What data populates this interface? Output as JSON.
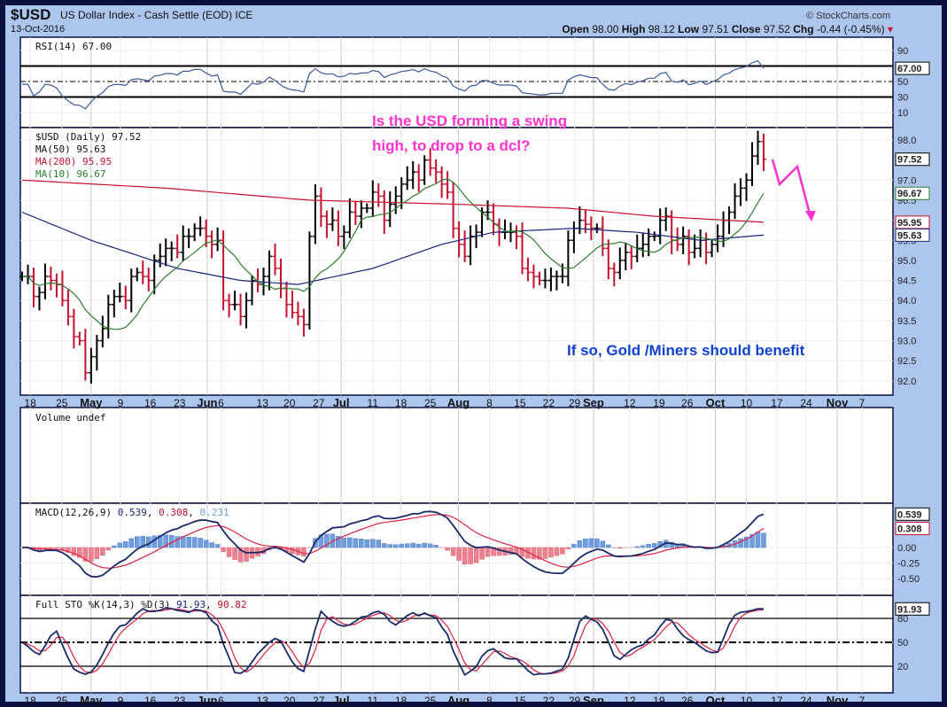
{
  "header": {
    "symbol": "$USD",
    "name": "US Dollar Index - Cash Settle (EOD) ICE",
    "date": "13-Oct-2016",
    "brand": "© StockCharts.com",
    "open_label": "Open",
    "open": "98.00",
    "high_label": "High",
    "high": "98.12",
    "low_label": "Low",
    "low": "97.51",
    "close_label": "Close",
    "close": "97.52",
    "chg_label": "Chg",
    "chg": "-0.44 (-0.45%)"
  },
  "annotations": {
    "question_line1": "Is the USD forming a swing",
    "question_line2": "high, to drop to a dcl?",
    "note": "If so, Gold /Miners should benefit"
  },
  "colors": {
    "up": "#000000",
    "down": "#c8102e",
    "ma50": "#1a237e",
    "ma200": "#c8102e",
    "ma10": "#2e7d32",
    "annot_pink": "#ff33cc",
    "annot_blue": "#1040d0",
    "rsi": "#3a5a9a",
    "hist_pos": "#6f9ee0",
    "hist_neg": "#f08090"
  },
  "chart_data": [
    {
      "type": "line",
      "title": "RSI(14) 67.00",
      "legend": "RSI(14) 67.00",
      "last_label": "67.00",
      "ylim": [
        0,
        100
      ],
      "yticks": [
        "90",
        "70",
        "50",
        "30",
        "10"
      ],
      "ytick_values": [
        90,
        70,
        50,
        30,
        10
      ],
      "levels": [
        70,
        50,
        30
      ]
    },
    {
      "type": "ohlc",
      "title": "$USD (Daily) 97.52",
      "last_label": "97.52",
      "ylim": [
        91.7,
        98.3
      ],
      "legend": [
        {
          "name": "MA(50) 95.63",
          "label": "95.63"
        },
        {
          "name": "MA(200) 95.95",
          "label": "95.95"
        },
        {
          "name": "MA(10) 96.67",
          "label": "96.67"
        }
      ],
      "yticks": [
        "98.0",
        "97.0",
        "96.5",
        "96.0",
        "95.5",
        "95.0",
        "94.5",
        "94.0",
        "93.5",
        "93.0",
        "92.5",
        "92.0"
      ],
      "ytick_values": [
        98,
        97,
        96.5,
        96,
        95.5,
        95,
        94.5,
        94,
        93.5,
        93,
        92.5,
        92
      ],
      "close": [
        94.6,
        94.6,
        94.1,
        94.2,
        94.6,
        94.5,
        94.4,
        94.0,
        93.6,
        93.1,
        93.0,
        92.2,
        92.6,
        93.0,
        93.3,
        93.9,
        94.1,
        94.1,
        94.0,
        94.6,
        94.7,
        94.6,
        94.5,
        95.0,
        95.1,
        95.3,
        95.3,
        95.2,
        95.6,
        95.6,
        95.8,
        95.8,
        95.6,
        95.4,
        95.5,
        94.0,
        93.9,
        93.9,
        93.6,
        94.0,
        94.5,
        94.4,
        94.6,
        95.1,
        94.8,
        94.3,
        93.9,
        93.7,
        93.6,
        93.4,
        95.6,
        96.6,
        96.1,
        95.9,
        96.0,
        95.6,
        95.7,
        96.2,
        96.1,
        96.3,
        96.3,
        96.7,
        96.6,
        96.0,
        96.4,
        96.6,
        96.9,
        97.0,
        97.2,
        97.0,
        97.5,
        97.3,
        97.2,
        96.9,
        96.7,
        95.8,
        95.4,
        95.1,
        95.6,
        95.7,
        96.2,
        96.2,
        95.9,
        95.7,
        95.7,
        95.7,
        95.6,
        94.8,
        94.7,
        94.6,
        94.5,
        94.5,
        94.6,
        94.6,
        94.6,
        95.5,
        95.8,
        96.0,
        95.9,
        95.8,
        95.8,
        95.3,
        94.8,
        94.7,
        95.0,
        95.2,
        95.1,
        95.3,
        95.4,
        95.6,
        95.6,
        96.0,
        96.1,
        95.5,
        95.4,
        95.6,
        95.2,
        95.3,
        95.5,
        95.2,
        95.4,
        95.6,
        96.0,
        96.2,
        96.6,
        96.8,
        97.0,
        97.6,
        97.96,
        97.52
      ],
      "ma50": [
        [
          0,
          96.2
        ],
        [
          12,
          95.5
        ],
        [
          27,
          94.8
        ],
        [
          38,
          94.5
        ],
        [
          48,
          94.4
        ],
        [
          61,
          94.8
        ],
        [
          73,
          95.4
        ],
        [
          82,
          95.7
        ],
        [
          96,
          95.8
        ],
        [
          107,
          95.7
        ],
        [
          118,
          95.5
        ],
        [
          129,
          95.63
        ]
      ],
      "ma200": [
        [
          0,
          97.0
        ],
        [
          25,
          96.8
        ],
        [
          50,
          96.5
        ],
        [
          75,
          96.4
        ],
        [
          95,
          96.3
        ],
        [
          110,
          96.1
        ],
        [
          129,
          95.95
        ]
      ]
    },
    {
      "type": "bar",
      "title": "Volume undef"
    },
    {
      "type": "line+bar",
      "title": "MACD(12,26,9)",
      "legend_values": [
        "0.539",
        "0.308",
        "0.231"
      ],
      "last_labels": [
        "0.539",
        "0.308"
      ],
      "yticks": [
        "0.00",
        "-0.25",
        "-0.50"
      ],
      "ytick_values": [
        0,
        -0.25,
        -0.5
      ]
    },
    {
      "type": "line",
      "title": "Full STO %K(14,3) %D(3)",
      "legend_values": [
        "91.93",
        "90.82"
      ],
      "last_label": "91.93",
      "yticks": [
        "80",
        "50",
        "20"
      ],
      "ytick_values": [
        80,
        50,
        20
      ]
    }
  ],
  "xaxis": {
    "ticks": [
      [
        "18",
        1.4,
        0
      ],
      [
        "25",
        6.9,
        0
      ],
      [
        "May",
        12,
        1
      ],
      [
        "9",
        17.1,
        0
      ],
      [
        "16",
        22.3,
        0
      ],
      [
        "23",
        27.4,
        0
      ],
      [
        "Jun",
        32.2,
        1
      ],
      [
        "6",
        34.6,
        0
      ],
      [
        "13",
        41.8,
        0
      ],
      [
        "20",
        46.5,
        0
      ],
      [
        "27",
        51.6,
        0
      ],
      [
        "Jul",
        55.5,
        1
      ],
      [
        "11",
        61,
        0
      ],
      [
        "18",
        65.9,
        0
      ],
      [
        "25",
        71,
        0
      ],
      [
        "Aug",
        75.9,
        1
      ],
      [
        "8",
        81.3,
        0
      ],
      [
        "15",
        86.6,
        0
      ],
      [
        "22",
        91.6,
        0
      ],
      [
        "29",
        96.1,
        0
      ],
      [
        "Sep",
        99.4,
        1
      ],
      [
        "12",
        105.7,
        0
      ],
      [
        "19",
        110.8,
        0
      ],
      [
        "26",
        115.7,
        0
      ],
      [
        "Oct",
        120.6,
        1
      ],
      [
        "10",
        126,
        0
      ],
      [
        "17",
        131.3,
        0
      ],
      [
        "24",
        136.4,
        0
      ],
      [
        "Nov",
        141.8,
        1
      ],
      [
        "7",
        146.1,
        0
      ]
    ]
  }
}
